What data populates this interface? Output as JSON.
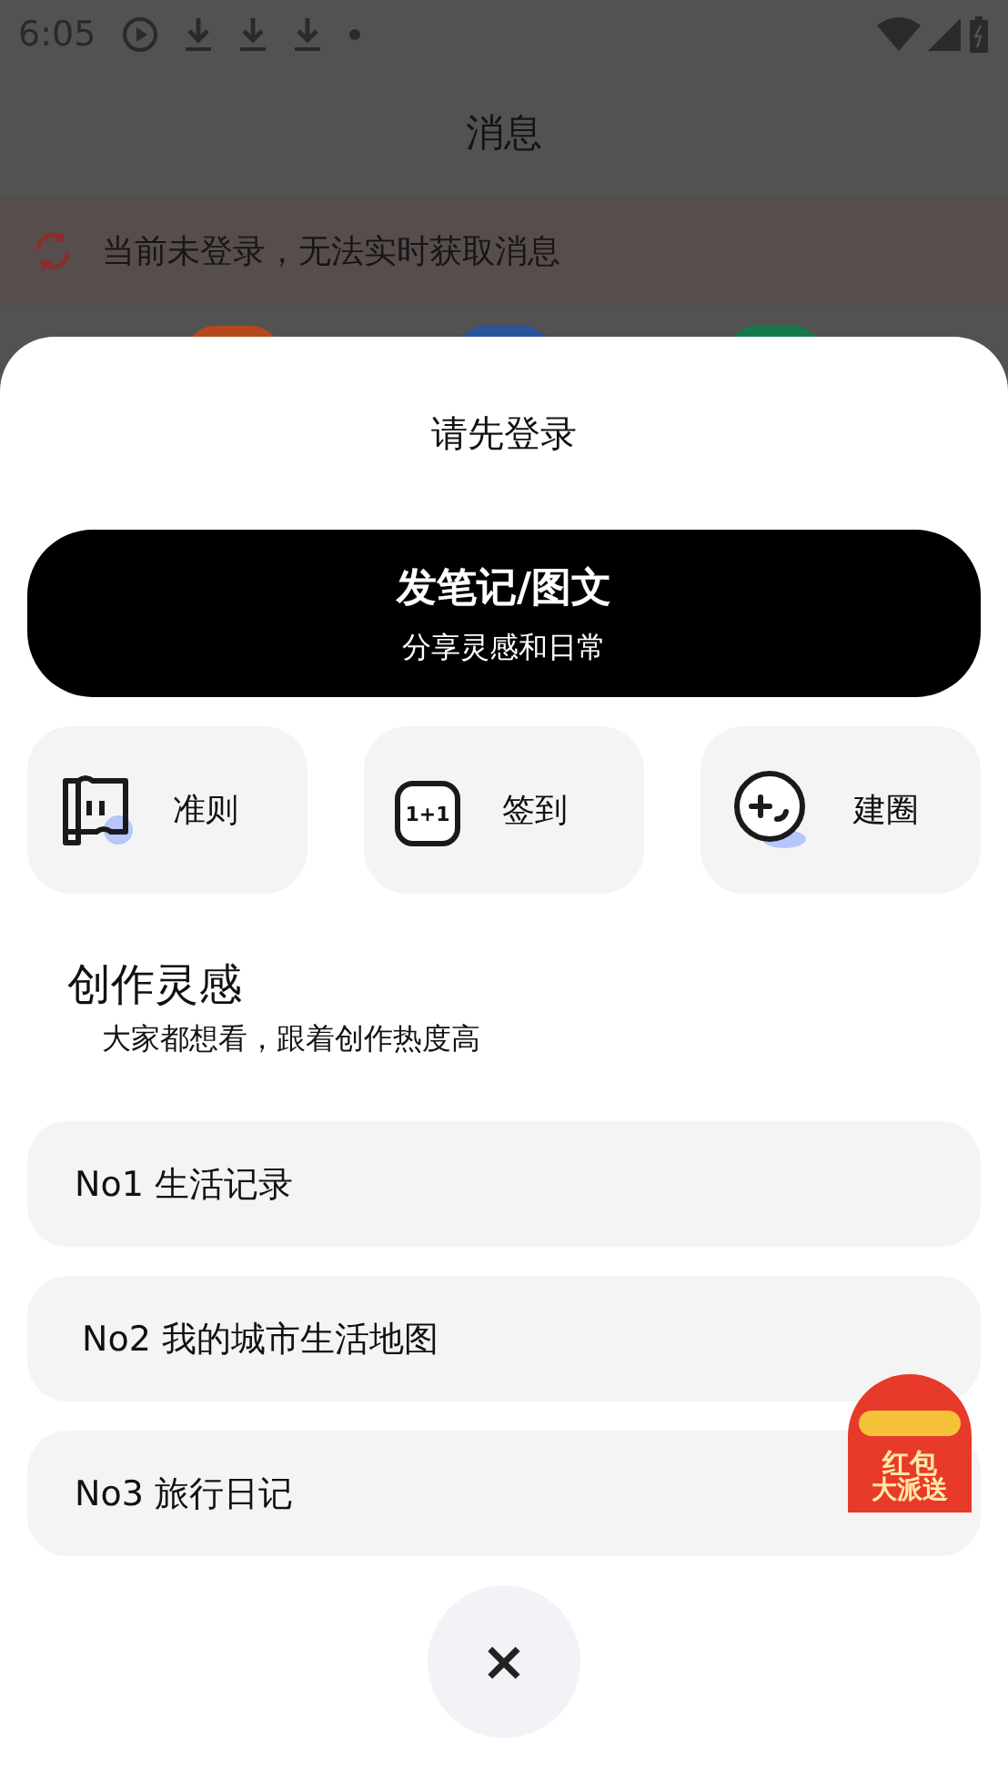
{
  "status_bar": {
    "time": "6:05",
    "notices": [
      {
        "kind": "play"
      },
      {
        "kind": "download"
      },
      {
        "kind": "download"
      },
      {
        "kind": "download"
      },
      {
        "kind": "dot"
      }
    ]
  },
  "background": {
    "title": "消息",
    "banner": "当前未登录，无法实时获取消息",
    "icons": [
      {
        "color": "#b5481c"
      },
      {
        "color": "#27549a"
      },
      {
        "color": "#16784a"
      }
    ]
  },
  "sheet": {
    "title": "请先登录",
    "primary": {
      "label": "发笔记/图文",
      "sublabel": "分享灵感和日常"
    },
    "actions": [
      {
        "kind": "guide",
        "label": "准则"
      },
      {
        "kind": "checkin",
        "label": "签到",
        "icon_text": "1+1"
      },
      {
        "kind": "circle",
        "label": "建圈"
      }
    ],
    "section": {
      "title": "创作灵感",
      "subtitle": "大家都想看，跟着创作热度高"
    },
    "topics": [
      {
        "label": "No1 生活记录"
      },
      {
        "label": "No2 我的城市生活地图"
      },
      {
        "label": "No3 旅行日记"
      }
    ],
    "close": "×",
    "promo": {
      "line1": "红包",
      "line2": "大派送"
    }
  }
}
